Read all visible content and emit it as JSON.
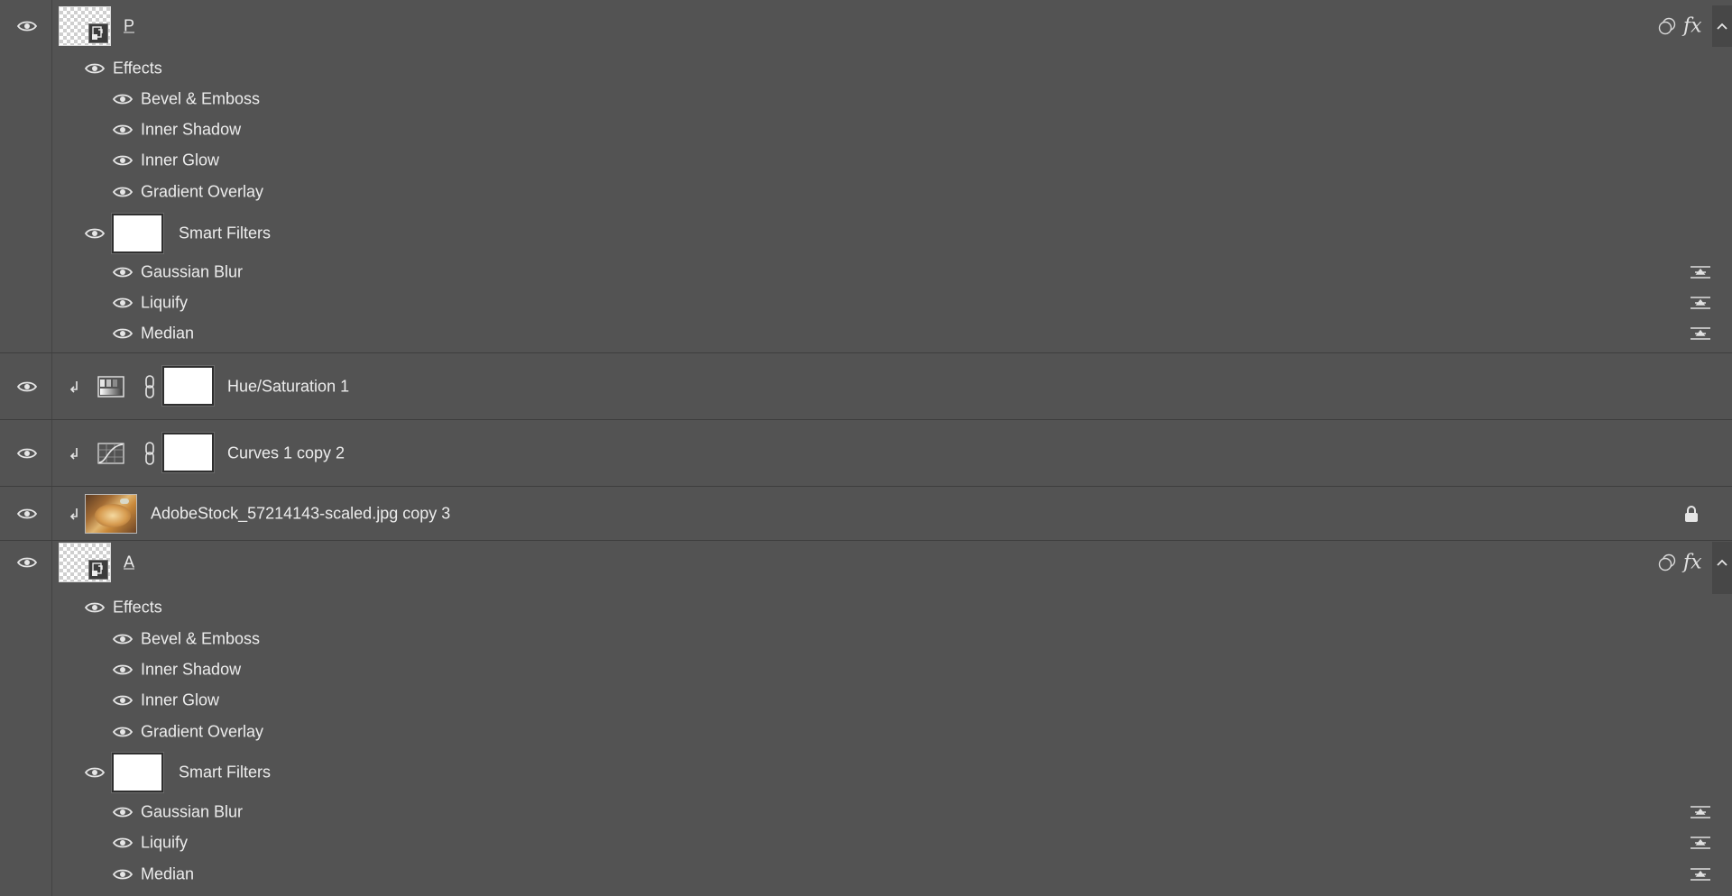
{
  "layers": {
    "p": {
      "name": "P",
      "effects_label": "Effects",
      "effects": [
        "Bevel & Emboss",
        "Inner Shadow",
        "Inner Glow",
        "Gradient Overlay"
      ],
      "smart_filters_label": "Smart Filters",
      "filters": [
        "Gaussian Blur",
        "Liquify",
        "Median"
      ],
      "fx_label": "fx"
    },
    "hue": {
      "name": "Hue/Saturation 1"
    },
    "curves": {
      "name": "Curves 1 copy 2"
    },
    "photo": {
      "name": "AdobeStock_57214143-scaled.jpg copy 3"
    },
    "a": {
      "name": "A",
      "effects_label": "Effects",
      "effects": [
        "Bevel & Emboss",
        "Inner Shadow",
        "Inner Glow",
        "Gradient Overlay"
      ],
      "smart_filters_label": "Smart Filters",
      "filters": [
        "Gaussian Blur",
        "Liquify",
        "Median"
      ],
      "fx_label": "fx"
    }
  },
  "icons": {
    "visibility": "eye-icon",
    "smart_object": "smart-object-icon",
    "blend": "blend-interior-icon",
    "fx": "fx-icon",
    "collapse": "chevron-up-icon",
    "filter_options": "filter-blending-options-icon",
    "clip": "clipping-mask-icon",
    "link": "link-icon",
    "hue_adj": "hue-saturation-adjustment-icon",
    "curves_adj": "curves-adjustment-icon",
    "lock": "lock-icon"
  },
  "colors": {
    "panel_bg": "#535353",
    "text": "#ececec",
    "separator": "#3e3e3e"
  }
}
